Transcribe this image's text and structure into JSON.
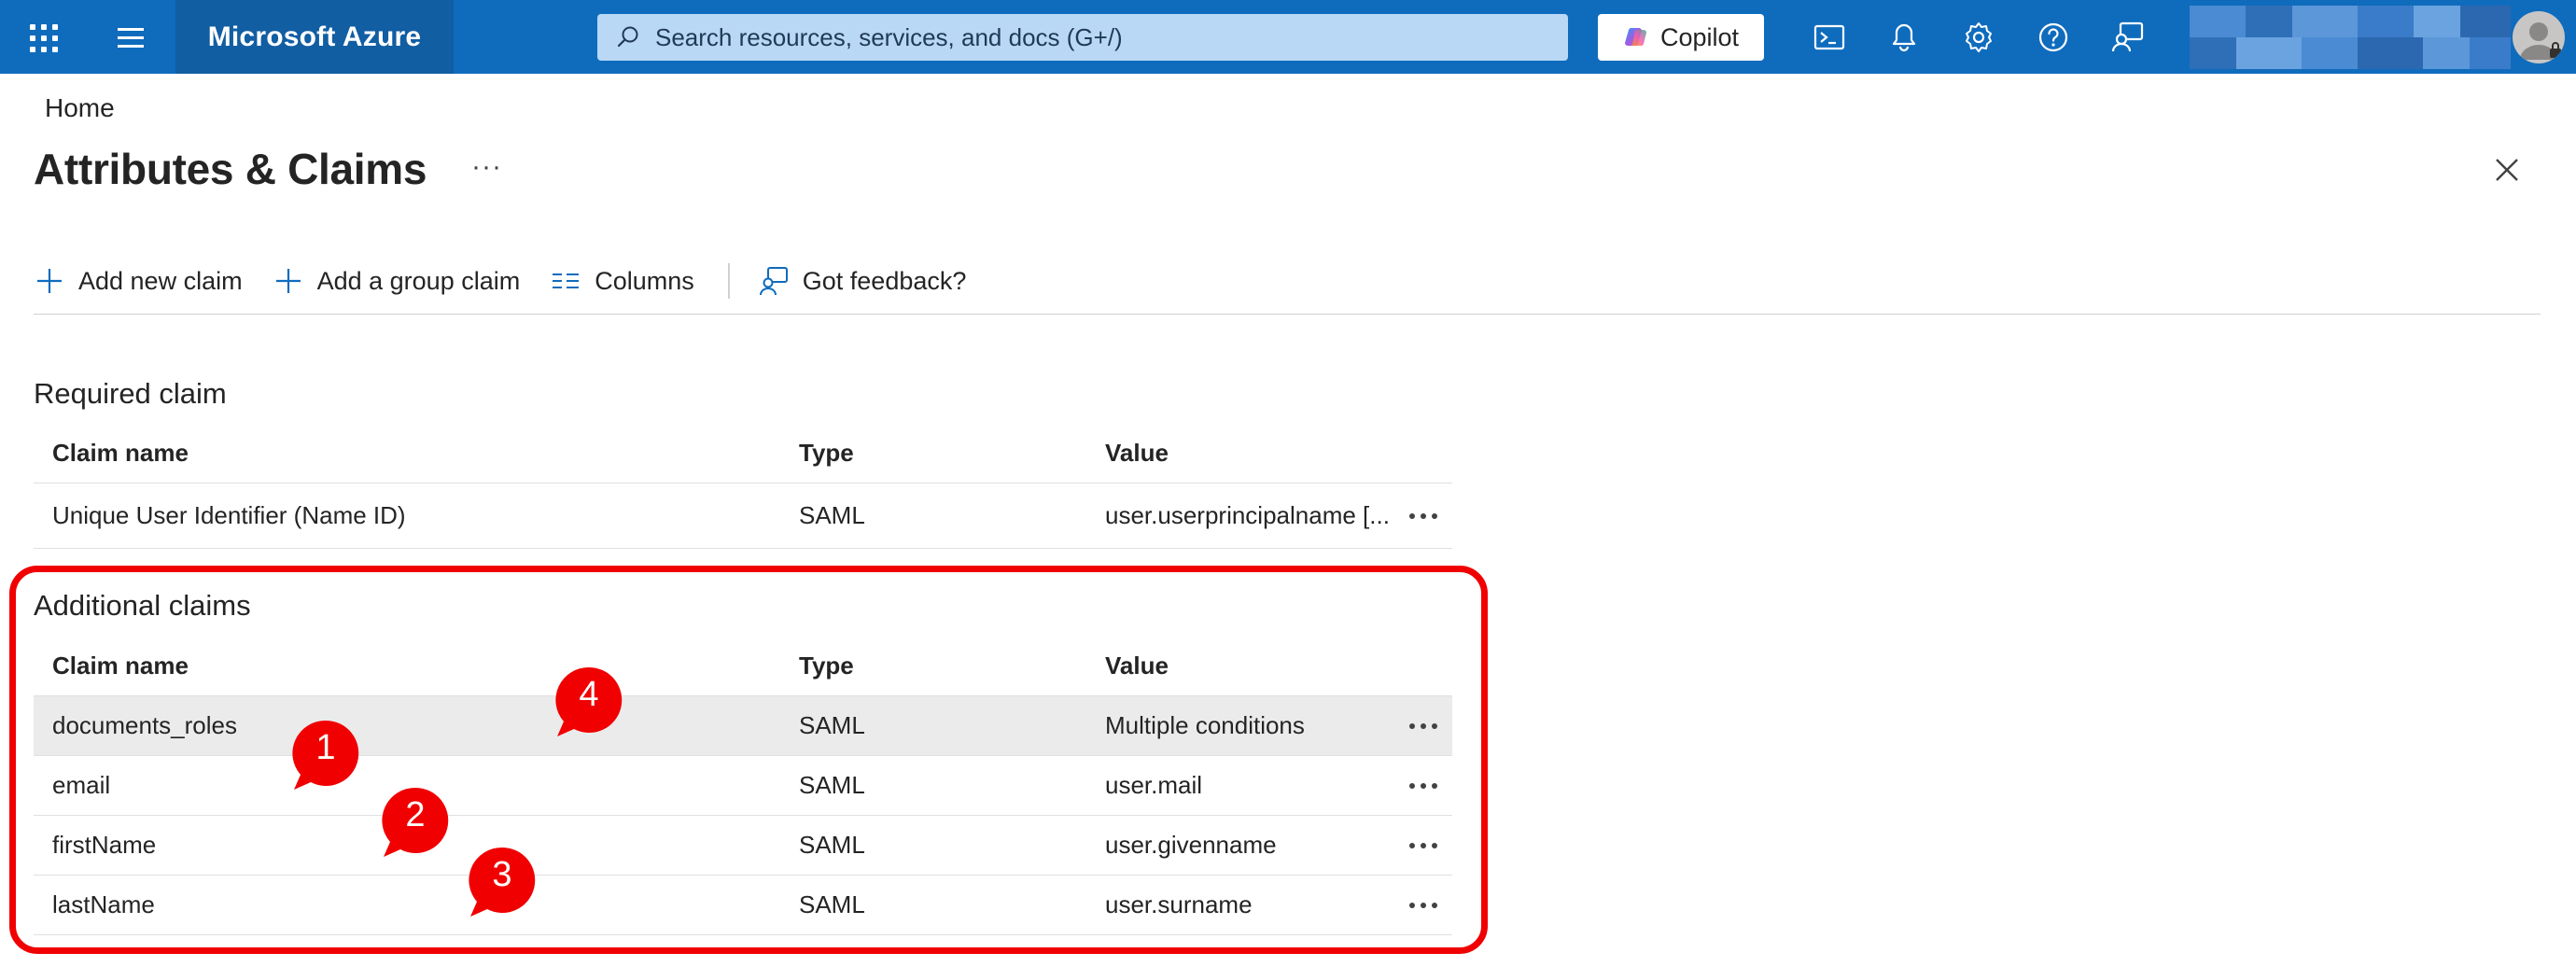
{
  "topbar": {
    "brand": "Microsoft Azure",
    "search_placeholder": "Search resources, services, and docs (G+/)",
    "copilot_label": "Copilot",
    "icons": [
      "waffle-icon",
      "hamburger-icon",
      "cloud-shell-icon",
      "notifications-icon",
      "settings-icon",
      "help-icon",
      "feedback-icon"
    ],
    "accent": "#0f6cbd"
  },
  "breadcrumb": "Home",
  "page": {
    "title": "Attributes & Claims",
    "more": "···"
  },
  "toolbar": {
    "add_claim": "Add new claim",
    "add_group_claim": "Add a group claim",
    "columns": "Columns",
    "feedback": "Got feedback?"
  },
  "required": {
    "title": "Required claim",
    "headers": [
      "Claim name",
      "Type",
      "Value"
    ],
    "rows": [
      {
        "name": "Unique User Identifier (Name ID)",
        "type": "SAML",
        "value": "user.userprincipalname [..."
      }
    ]
  },
  "additional": {
    "title": "Additional claims",
    "headers": [
      "Claim name",
      "Type",
      "Value"
    ],
    "rows": [
      {
        "name": "documents_roles",
        "type": "SAML",
        "value": "Multiple conditions"
      },
      {
        "name": "email",
        "type": "SAML",
        "value": "user.mail"
      },
      {
        "name": "firstName",
        "type": "SAML",
        "value": "user.givenname"
      },
      {
        "name": "lastName",
        "type": "SAML",
        "value": "user.surname"
      }
    ]
  },
  "annotations": {
    "markers": [
      "1",
      "2",
      "3",
      "4"
    ],
    "color": "#f00000"
  }
}
